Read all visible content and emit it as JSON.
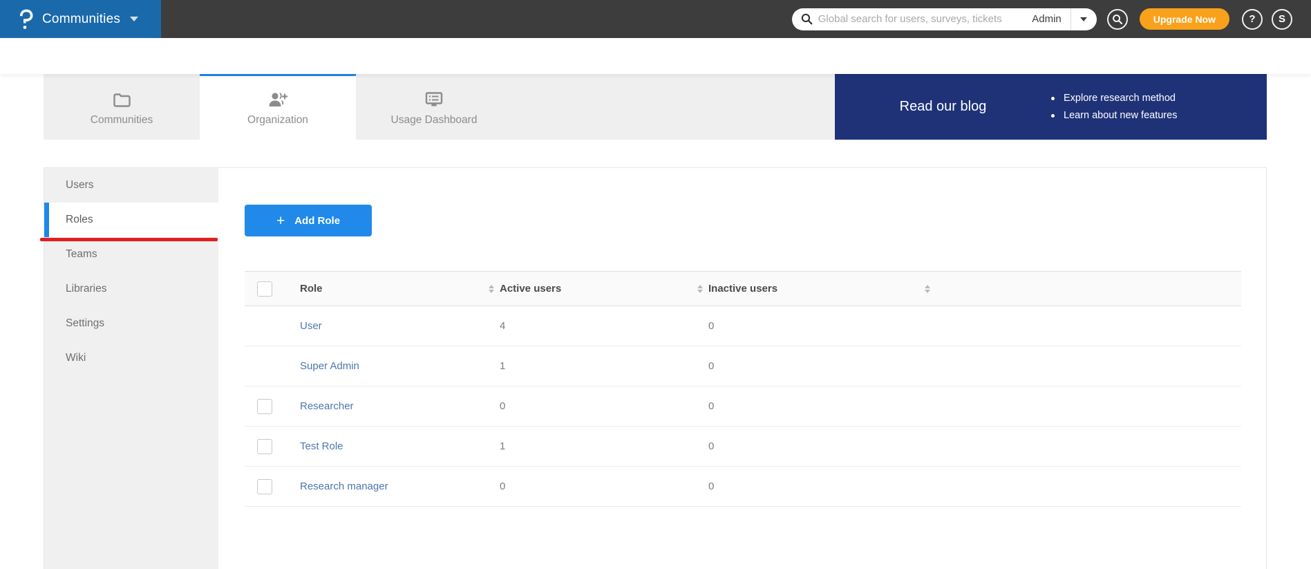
{
  "colors": {
    "topbar-bg": "#3d3d3d",
    "brand-blue": "#1a6aab",
    "accent-blue": "#1e88e5",
    "button-blue": "#2089ea",
    "banner-navy": "#1f3278",
    "upgrade-orange": "#f9a11b",
    "link-blue": "#4d77ad",
    "annotation-red": "#e02020"
  },
  "topbar": {
    "brand": {
      "logo": "p-question-mark",
      "label": "Communities"
    },
    "search": {
      "placeholder": "Global search for users, surveys, tickets",
      "scope": "Admin"
    },
    "upgrade_label": "Upgrade Now",
    "help_label": "?",
    "avatar_initial": "S"
  },
  "tabs": [
    {
      "label": "Communities",
      "icon": "folder-icon",
      "active": false
    },
    {
      "label": "Organization",
      "icon": "person-add-icon",
      "active": true
    },
    {
      "label": "Usage Dashboard",
      "icon": "dashboard-icon",
      "active": false
    }
  ],
  "banner": {
    "title": "Read our blog",
    "bullets": [
      "Explore research method",
      "Learn about new features"
    ]
  },
  "sidebar": {
    "items": [
      {
        "label": "Users",
        "active": false
      },
      {
        "label": "Roles",
        "active": true
      },
      {
        "label": "Teams",
        "active": false
      },
      {
        "label": "Libraries",
        "active": false
      },
      {
        "label": "Settings",
        "active": false
      },
      {
        "label": "Wiki",
        "active": false
      }
    ]
  },
  "content": {
    "add_role_label": "Add Role",
    "table": {
      "columns": [
        "Role",
        "Active users",
        "Inactive users"
      ],
      "rows": [
        {
          "role": "User",
          "active_users": "4",
          "inactive_users": "0",
          "has_checkbox": false
        },
        {
          "role": "Super Admin",
          "active_users": "1",
          "inactive_users": "0",
          "has_checkbox": false
        },
        {
          "role": "Researcher",
          "active_users": "0",
          "inactive_users": "0",
          "has_checkbox": true
        },
        {
          "role": "Test Role",
          "active_users": "1",
          "inactive_users": "0",
          "has_checkbox": true
        },
        {
          "role": "Research manager",
          "active_users": "0",
          "inactive_users": "0",
          "has_checkbox": true
        }
      ]
    }
  }
}
